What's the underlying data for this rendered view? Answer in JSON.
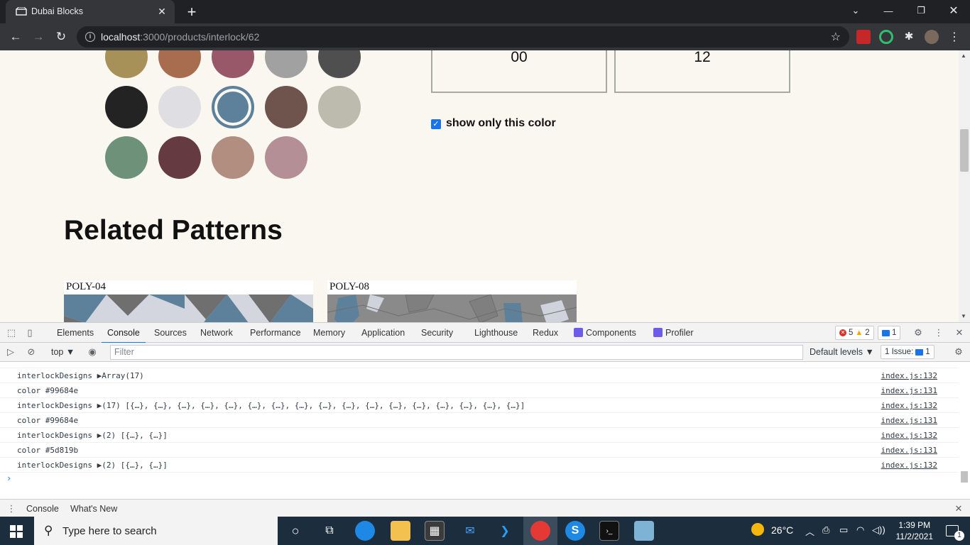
{
  "browser": {
    "tab_title": "Dubai Blocks",
    "url_host": "localhost",
    "url_path": ":3000/products/interlock/62"
  },
  "page": {
    "swatches": [
      "#a89158",
      "#a86c4e",
      "#99576a",
      "#a1a1a1",
      "#4f4f4f",
      "#232324",
      "#dfdfe3",
      "#5d819b",
      "#6e544d",
      "#bdbbae",
      "#6d9179",
      "#663a41",
      "#b18e7f",
      "#b48f96"
    ],
    "selected_swatch_index": 7,
    "box_left_value": "00",
    "box_right_value": "12",
    "checkbox_label": "show only this color",
    "checkbox_checked": true,
    "section_heading": "Related Patterns",
    "patterns": [
      {
        "label": "POLY-04"
      },
      {
        "label": "POLY-08"
      }
    ]
  },
  "devtools": {
    "tabs": [
      "Elements",
      "Console",
      "Sources",
      "Network",
      "Performance",
      "Memory",
      "Application",
      "Security",
      "Lighthouse",
      "Redux",
      "Components",
      "Profiler"
    ],
    "active_tab": "Console",
    "errors_count": "5",
    "warnings_count": "2",
    "messages_count": "1",
    "context": "top",
    "filter_placeholder": "Filter",
    "levels": "Default levels ▼",
    "issues_label": "1 Issue:",
    "issues_count": "1",
    "console_rows": [
      {
        "msg": "interlockDesigns ▶Array(17)",
        "src": "index.js:132"
      },
      {
        "msg": "color #99684e",
        "src": "index.js:131"
      },
      {
        "msg": "interlockDesigns ▶(17) [{…}, {…}, {…}, {…}, {…}, {…}, {…}, {…}, {…}, {…}, {…}, {…}, {…}, {…}, {…}, {…}, {…}]",
        "src": "index.js:132"
      },
      {
        "msg": "color #99684e",
        "src": "index.js:131"
      },
      {
        "msg": "interlockDesigns ▶(2) [{…}, {…}]",
        "src": "index.js:132"
      },
      {
        "msg": "color #5d819b",
        "src": "index.js:131"
      },
      {
        "msg": "interlockDesigns ▶(2) [{…}, {…}]",
        "src": "index.js:132"
      }
    ],
    "drawer_tabs": [
      "Console",
      "What's New"
    ]
  },
  "taskbar": {
    "search_placeholder": "Type here to search",
    "weather": "26°C",
    "time": "1:39 PM",
    "date": "11/2/2021",
    "notification_count": "1"
  }
}
